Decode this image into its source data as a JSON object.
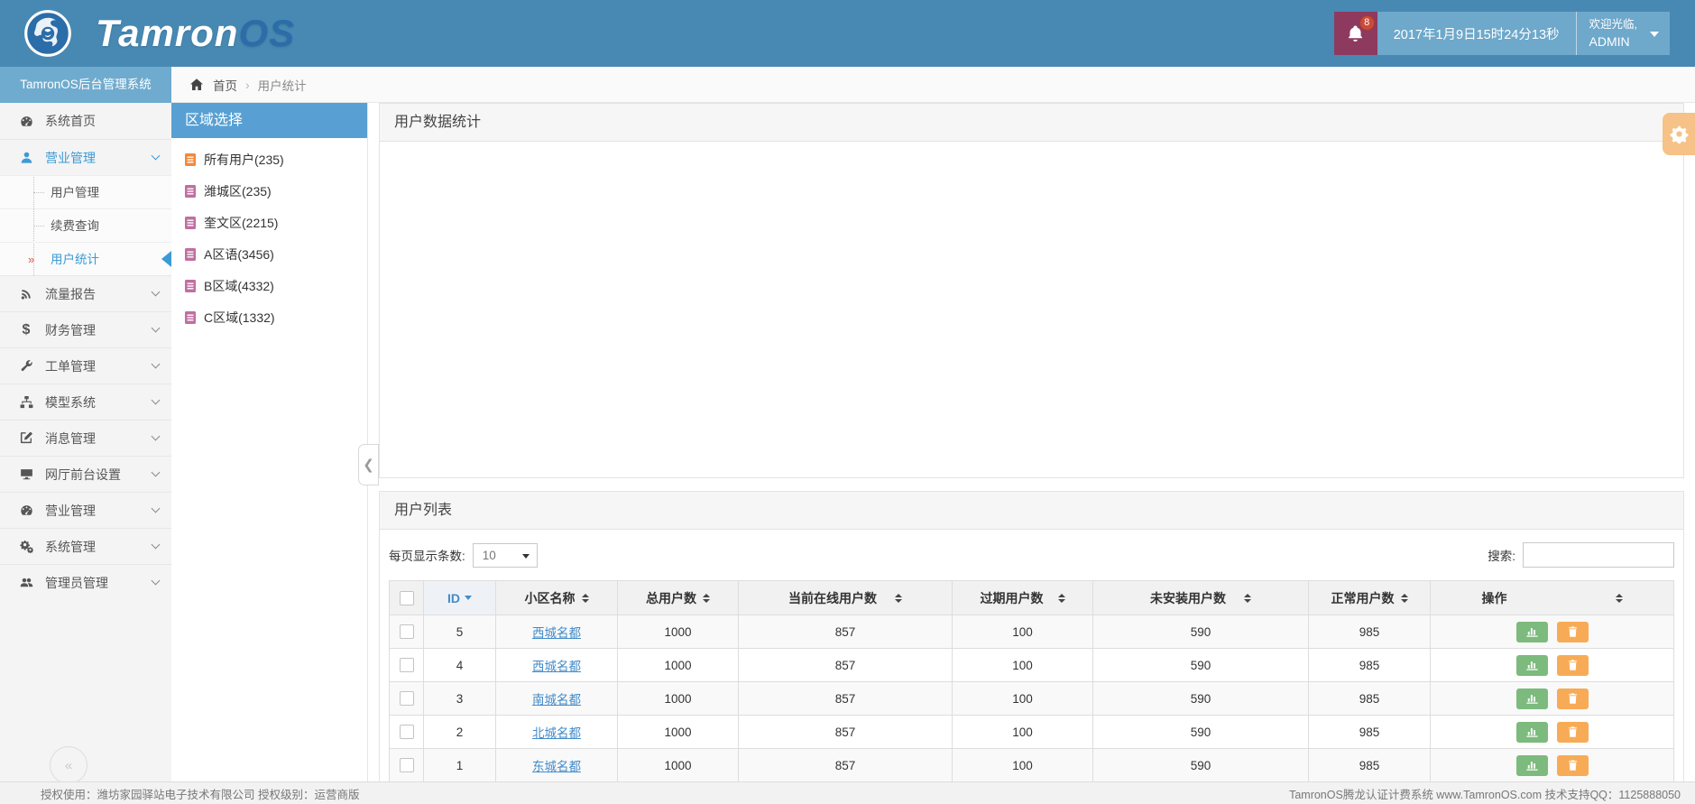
{
  "brand": {
    "logo_primary": "Tamron",
    "logo_secondary": "OS",
    "system_title": "TamronOS后台管理系统"
  },
  "topbar": {
    "notification_count": "8",
    "datetime": "2017年1月9日15时24分13秒",
    "welcome": "欢迎光临,",
    "username": "ADMIN"
  },
  "breadcrumb": {
    "home": "首页",
    "separator": "›",
    "current": "用户统计"
  },
  "sidebar": {
    "items": [
      {
        "label": "系统首页",
        "icon": "dashboard-icon"
      },
      {
        "label": "营业管理",
        "icon": "user-icon",
        "expanded": true,
        "children": [
          {
            "label": "用户管理"
          },
          {
            "label": "续费查询"
          },
          {
            "label": "用户统计",
            "active": true
          }
        ]
      },
      {
        "label": "流量报告",
        "icon": "signal-icon"
      },
      {
        "label": "财务管理",
        "icon": "dollar-icon"
      },
      {
        "label": "工单管理",
        "icon": "wrench-icon"
      },
      {
        "label": "模型系统",
        "icon": "sitemap-icon"
      },
      {
        "label": "消息管理",
        "icon": "edit-icon"
      },
      {
        "label": "网厅前台设置",
        "icon": "desktop-icon"
      },
      {
        "label": "营业管理",
        "icon": "dashboard-icon"
      },
      {
        "label": "系统管理",
        "icon": "gears-icon"
      },
      {
        "label": "管理员管理",
        "icon": "users-icon"
      }
    ],
    "collapse_glyph": "«"
  },
  "region_panel": {
    "title": "区域选择",
    "items": [
      {
        "label": "所有用户(235)"
      },
      {
        "label": "潍城区(235)"
      },
      {
        "label": "奎文区(2215)"
      },
      {
        "label": "A区语(3456)"
      },
      {
        "label": "B区域(4332)"
      },
      {
        "label": "C区域(1332)"
      }
    ]
  },
  "stats_panel": {
    "title": "用户数据统计"
  },
  "list_panel": {
    "title": "用户列表",
    "page_size_label": "每页显示条数:",
    "page_size_value": "10",
    "search_label": "搜索:",
    "table": {
      "columns": [
        "ID",
        "小区名称",
        "总用户数",
        "当前在线用户数",
        "过期用户数",
        "未安装用户数",
        "正常用户数",
        "操作"
      ],
      "rows": [
        {
          "id": "5",
          "name": "西城名都",
          "total": "1000",
          "online": "857",
          "expired": "100",
          "uninstalled": "590",
          "normal": "985"
        },
        {
          "id": "4",
          "name": "西城名都",
          "total": "1000",
          "online": "857",
          "expired": "100",
          "uninstalled": "590",
          "normal": "985"
        },
        {
          "id": "3",
          "name": "南城名都",
          "total": "1000",
          "online": "857",
          "expired": "100",
          "uninstalled": "590",
          "normal": "985"
        },
        {
          "id": "2",
          "name": "北城名都",
          "total": "1000",
          "online": "857",
          "expired": "100",
          "uninstalled": "590",
          "normal": "985"
        },
        {
          "id": "1",
          "name": "东城名都",
          "total": "1000",
          "online": "857",
          "expired": "100",
          "uninstalled": "590",
          "normal": "985"
        }
      ]
    }
  },
  "footer": {
    "license": "授权使用：潍坊家园驿站电子技术有限公司  授权级别：运营商版",
    "support": "TamronOS腾龙认证计费系统 www.TamronOS.com 技术支持QQ：1125888050"
  },
  "colors": {
    "header": "#4789b3",
    "header_light": "#6ea8cb",
    "notification_box": "#8e3a5e",
    "badge": "#c94b3a",
    "panel_accent": "#58a0d3",
    "active_link": "#3b9bd5",
    "link": "#428bca",
    "button_green": "#7dba7d",
    "button_orange": "#f8ab57",
    "settings_tab": "#f6c287"
  }
}
